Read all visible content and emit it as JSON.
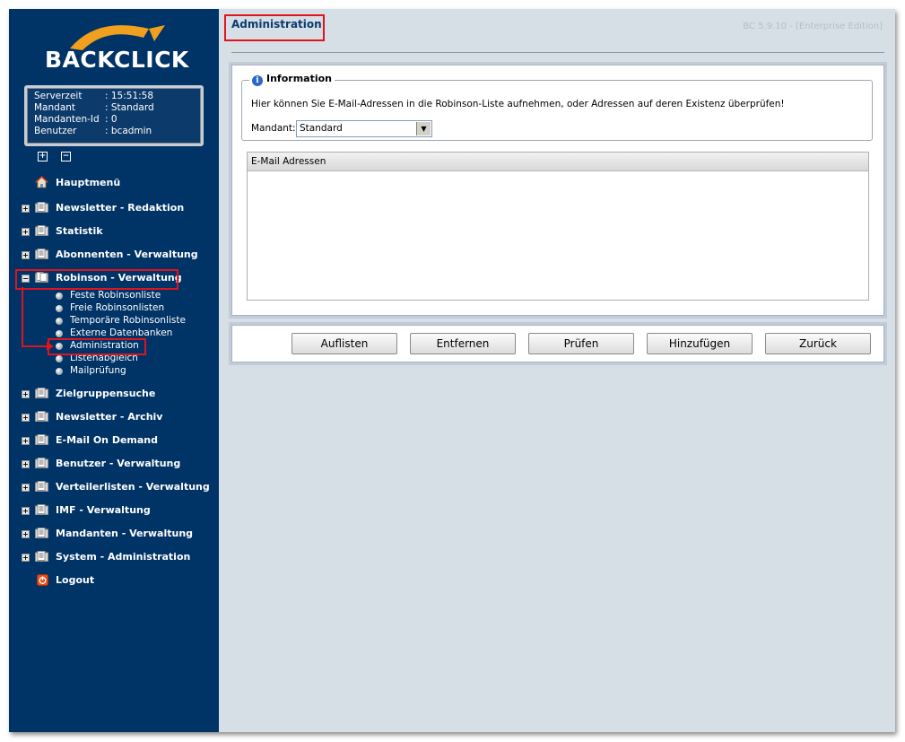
{
  "app": {
    "logo": "BACKCLICK",
    "version": "BC 5.9.10 - [Enterprise Edition]"
  },
  "info": {
    "rows": [
      {
        "key": "Serverzeit",
        "value": ": 15:51:58"
      },
      {
        "key": "Mandant",
        "value": ": Standard"
      },
      {
        "key": "Mandanten-Id",
        "value": ": 0"
      },
      {
        "key": "Benutzer",
        "value": ": bcadmin"
      }
    ]
  },
  "toolbar": {
    "expand": "+",
    "collapse": "−"
  },
  "nav": {
    "hauptmenue": "Hauptmenü",
    "newsletter_redaktion": "Newsletter - Redaktion",
    "statistik": "Statistik",
    "abonnenten": "Abonnenten - Verwaltung",
    "robinson": "Robinson - Verwaltung",
    "robinson_sub": [
      "Feste Robinsonliste",
      "Freie Robinsonlisten",
      "Temporäre Robinsonliste",
      "Externe Datenbanken",
      "Administration",
      "Listenabgleich",
      "Mailprüfung"
    ],
    "zielgruppen": "Zielgruppensuche",
    "archiv": "Newsletter - Archiv",
    "email_on_demand": "E-Mail On Demand",
    "benutzer": "Benutzer - Verwaltung",
    "verteiler": "Verteilerlisten - Verwaltung",
    "imf": "IMF - Verwaltung",
    "mandanten": "Mandanten - Verwaltung",
    "system": "System - Administration",
    "logout": "Logout"
  },
  "main": {
    "title": "Administration",
    "info_legend": "Information",
    "info_icon": "i",
    "description": "Hier können Sie E-Mail-Adressen in die Robinson-Liste aufnehmen, oder Adressen auf deren Existenz überprüfen!",
    "mandant_label": "Mandant:",
    "mandant_value": "Standard",
    "list_header": "E-Mail Adressen"
  },
  "buttons": {
    "auflisten": "Auflisten",
    "entfernen": "Entfernen",
    "pruefen": "Prüfen",
    "hinzufuegen": "Hinzufügen",
    "zurueck": "Zurück"
  },
  "colors": {
    "sidebar": "#003366",
    "highlight": "#e0141e",
    "accent": "#f0a01e"
  }
}
